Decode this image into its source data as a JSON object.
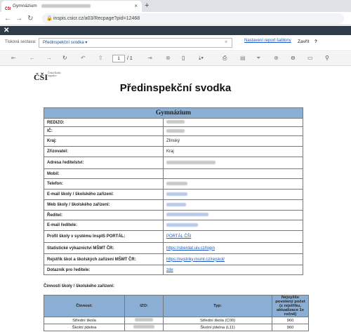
{
  "browser": {
    "tab_title": "Gymnázium",
    "tab_favicon": "ČŠI",
    "url": "inspis.csicr.cz/a03/Recpage?pid=12468"
  },
  "report_bar": {
    "label": "Tisková sestava:",
    "selected": "Předinspekční svodka ▾",
    "settings_link": "Nastavení report šablony",
    "close_label": "Zavřít",
    "help": "?"
  },
  "viewer": {
    "page_current": "1",
    "page_total": "/ 1"
  },
  "document": {
    "logo_text": "ČŠI",
    "logo_sub": "Česká školní inspekce",
    "title": "Předinspekční svodka",
    "school_header": "Gymnázium",
    "rows": [
      {
        "key": "REDIZO:",
        "value": ""
      },
      {
        "key": "IČ:",
        "value": ""
      },
      {
        "key": "Kraj:",
        "value": "Zlínský"
      },
      {
        "key": "Zřizovatel:",
        "value": "Kraj"
      },
      {
        "key": "Adresa ředitelství:",
        "value": ""
      },
      {
        "key": "Mobil:",
        "value": ""
      },
      {
        "key": "Telefon:",
        "value": ""
      },
      {
        "key": "E-mail školy / školského zařízení:",
        "value": ""
      },
      {
        "key": "Web školy / školského zařízení:",
        "value": ""
      },
      {
        "key": "Ředitel:",
        "value": ""
      },
      {
        "key": "E-mail ředitele:",
        "value": ""
      },
      {
        "key": "Profil školy v systému InspIS PORTÁL:",
        "value": "PORTÁL ČŠI"
      },
      {
        "key": "Statistické výkaznictví MŠMT ČR:",
        "value": "https://sberdat.uiv.cz/login"
      },
      {
        "key": "Rejstřík škol a školských zařízení MŠMT ČR:",
        "value": "https://rejstriky.msmt.cz/rejskol/"
      },
      {
        "key": "Dotazník pro ředitele:",
        "value": "zde"
      }
    ],
    "activities_title": "Činnosti školy / školského zařízení:",
    "activities_headers": [
      "Činnost:",
      "IZO:",
      "Typ:",
      "Nejvyšše povolený počet (z rejstříku, aktualizace 1x ročně)"
    ],
    "activities": [
      {
        "name": "Střední škola",
        "izo": "",
        "type": "Střední škola (C00)",
        "count": "960"
      },
      {
        "name": "Školní jídelna",
        "izo": "",
        "type": "Školní jídelna (L11)",
        "count": "960"
      }
    ]
  }
}
